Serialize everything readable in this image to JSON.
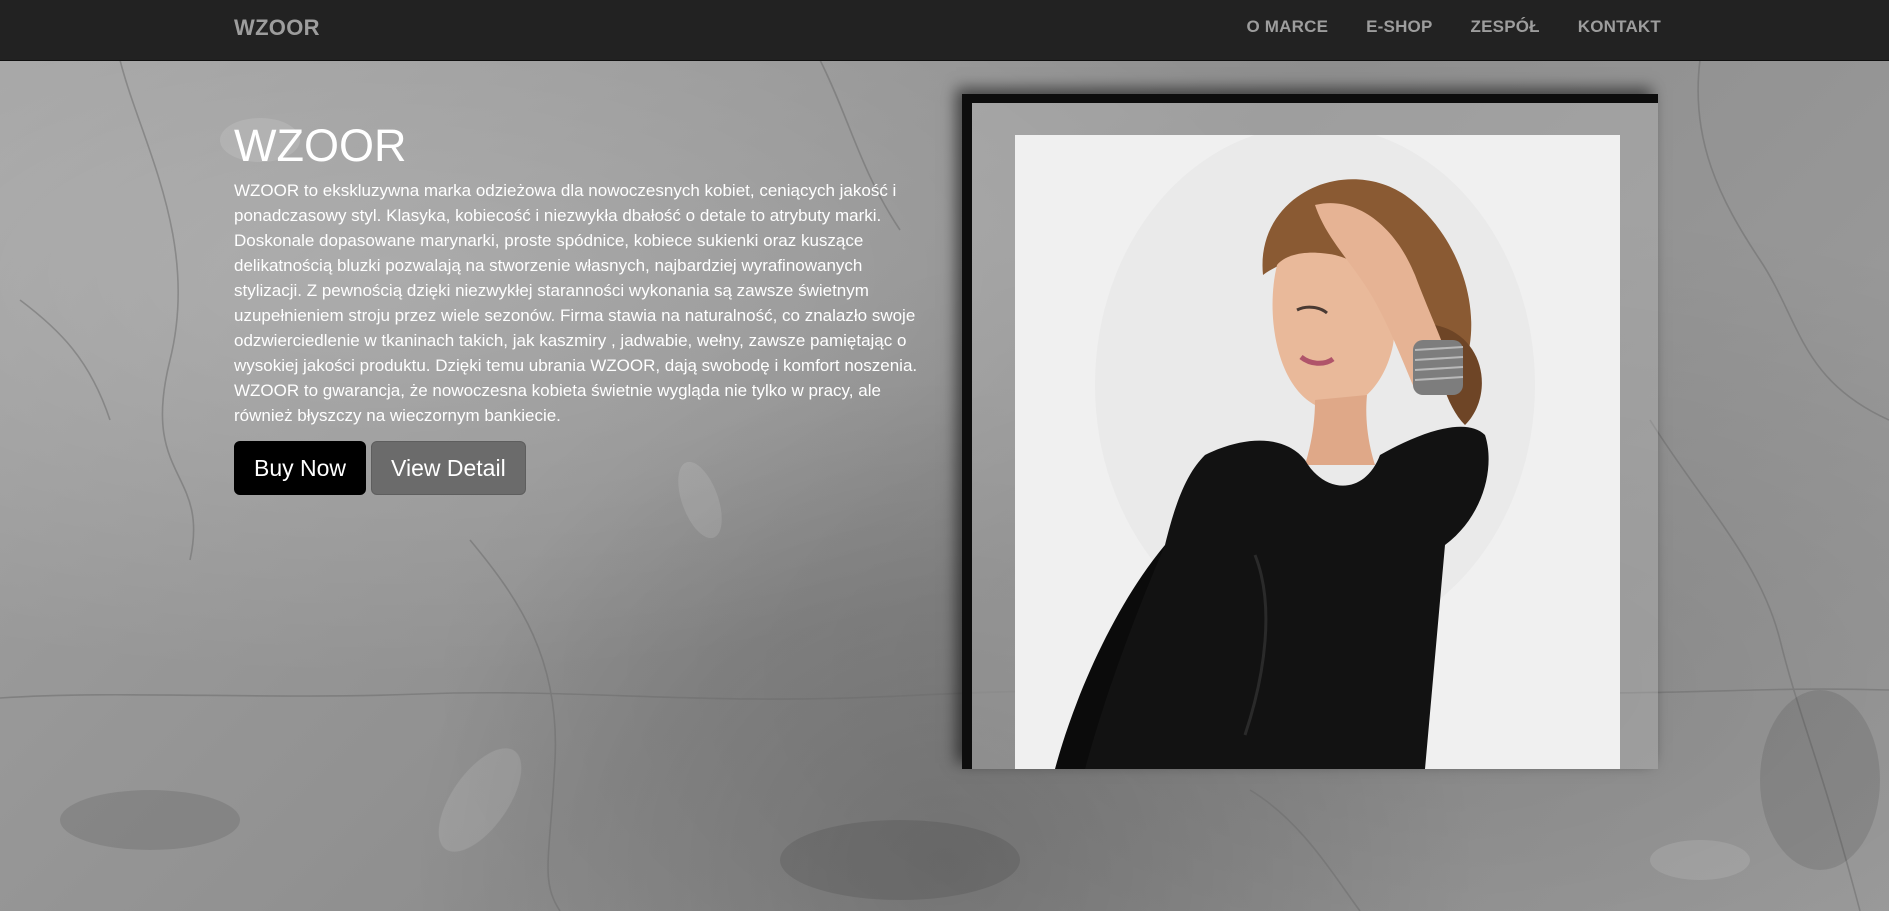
{
  "navbar": {
    "brand": "WZOOR",
    "links": [
      "O MARCE",
      "E-SHOP",
      "ZESPÓŁ",
      "KONTAKT"
    ]
  },
  "hero": {
    "title": "WZOOR",
    "description": "WZOOR to ekskluzywna marka odzieżowa dla nowoczesnych kobiet, ceniących jakość i ponadczasowy styl. Klasyka, kobiecość i niezwykła dbałość o detale to atrybuty marki. Doskonale dopasowane marynarki, proste spódnice, kobiece sukienki oraz kuszące delikatnością bluzki pozwalają na stworzenie własnych, najbardziej wyrafinowanych stylizacji. Z pewnością dzięki niezwykłej staranności wykonania są zawsze świetnym uzupełnieniem stroju przez wiele sezonów. Firma stawia na naturalność, co znalazło swoje odzwierciedlenie w tkaninach takich, jak kaszmiry , jadwabie, wełny, zawsze pamiętając o wysokiej jakości produktu. Dzięki temu ubrania WZOOR, dają swobodę i komfort noszenia. WZOOR to gwarancja, że nowoczesna kobieta świetnie wygląda nie tylko w pracy, ale również błyszczy na wieczornym bankiecie.",
    "buy_label": "Buy Now",
    "detail_label": "View Detail"
  },
  "colors": {
    "navbar_bg": "#222222",
    "nav_text": "#9d9d9d",
    "buy_button": "#000000",
    "detail_button": "#6b6b6b"
  }
}
